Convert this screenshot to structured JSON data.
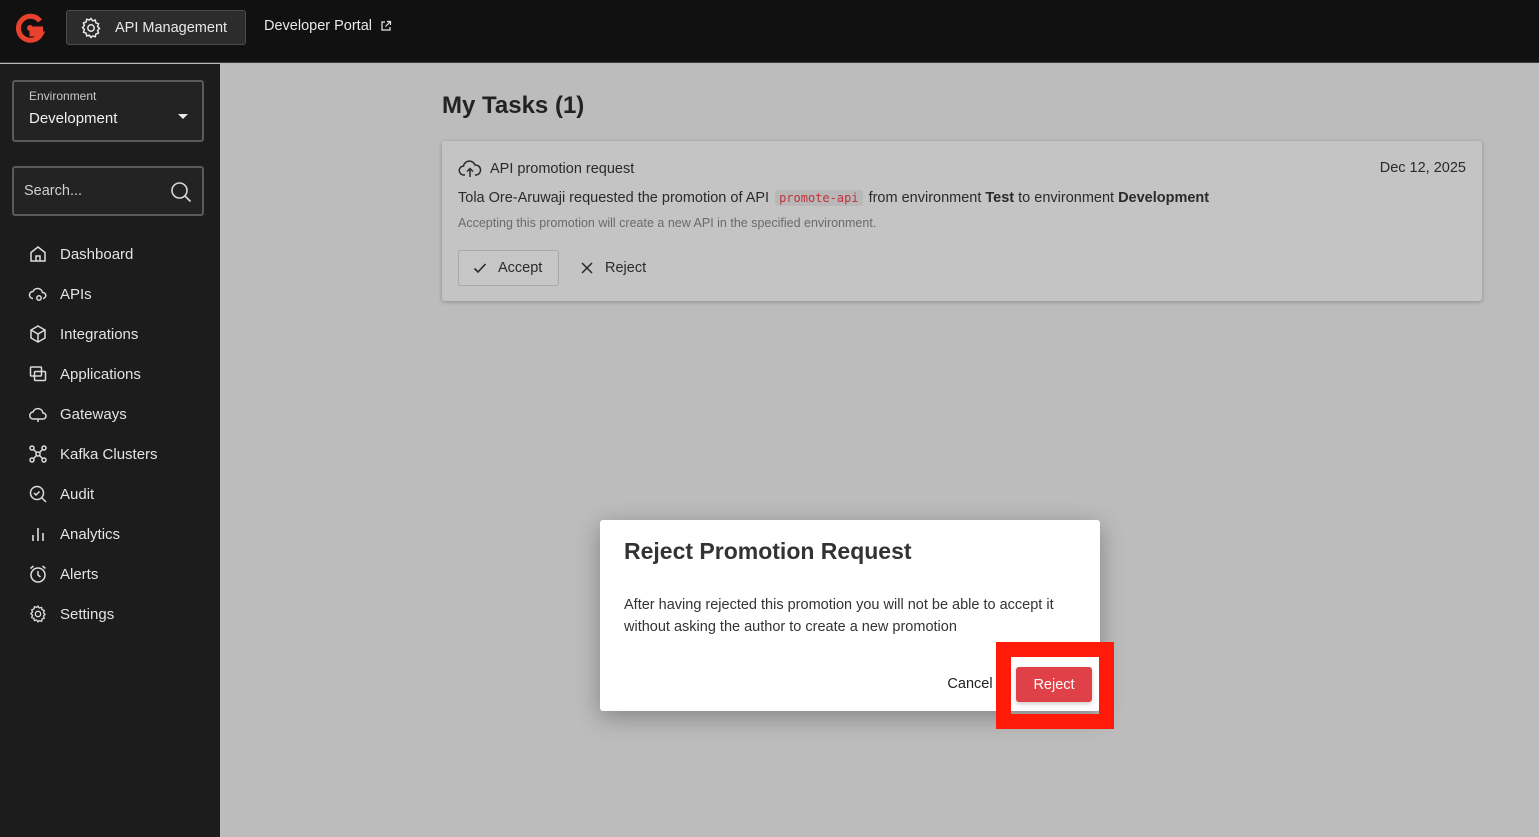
{
  "topbar": {
    "app_name": "API Management",
    "portal_link": "Developer Portal"
  },
  "sidebar": {
    "environment": {
      "label": "Environment",
      "value": "Development"
    },
    "search": {
      "placeholder": "Search..."
    },
    "items": [
      {
        "label": "Dashboard",
        "icon": "home-icon"
      },
      {
        "label": "APIs",
        "icon": "cloud-gear-icon"
      },
      {
        "label": "Integrations",
        "icon": "cube-icon"
      },
      {
        "label": "Applications",
        "icon": "windows-icon"
      },
      {
        "label": "Gateways",
        "icon": "cloud-icon"
      },
      {
        "label": "Kafka Clusters",
        "icon": "nodes-icon"
      },
      {
        "label": "Audit",
        "icon": "search-check-icon"
      },
      {
        "label": "Analytics",
        "icon": "bar-chart-icon"
      },
      {
        "label": "Alerts",
        "icon": "alarm-icon"
      },
      {
        "label": "Settings",
        "icon": "gear-icon"
      }
    ]
  },
  "main": {
    "title": "My Tasks (1)",
    "task": {
      "type": "API promotion request",
      "date": "Dec 12, 2025",
      "requester": "Tola Ore-Aruwaji",
      "text_requested": "requested the promotion of API",
      "api_name": "promote-api",
      "text_from": "from environment",
      "source_env": "Test",
      "text_to": "to environment",
      "target_env": "Development",
      "note": "Accepting this promotion will create a new API in the specified environment.",
      "accept_label": "Accept",
      "reject_label": "Reject"
    }
  },
  "dialog": {
    "title": "Reject Promotion Request",
    "body": "After having rejected this promotion you will not be able to accept it without asking the author to create a new promotion",
    "cancel_label": "Cancel",
    "confirm_label": "Reject"
  },
  "colors": {
    "danger": "#e04048",
    "highlight": "#ff1a0a",
    "logo": "#e8412e"
  }
}
